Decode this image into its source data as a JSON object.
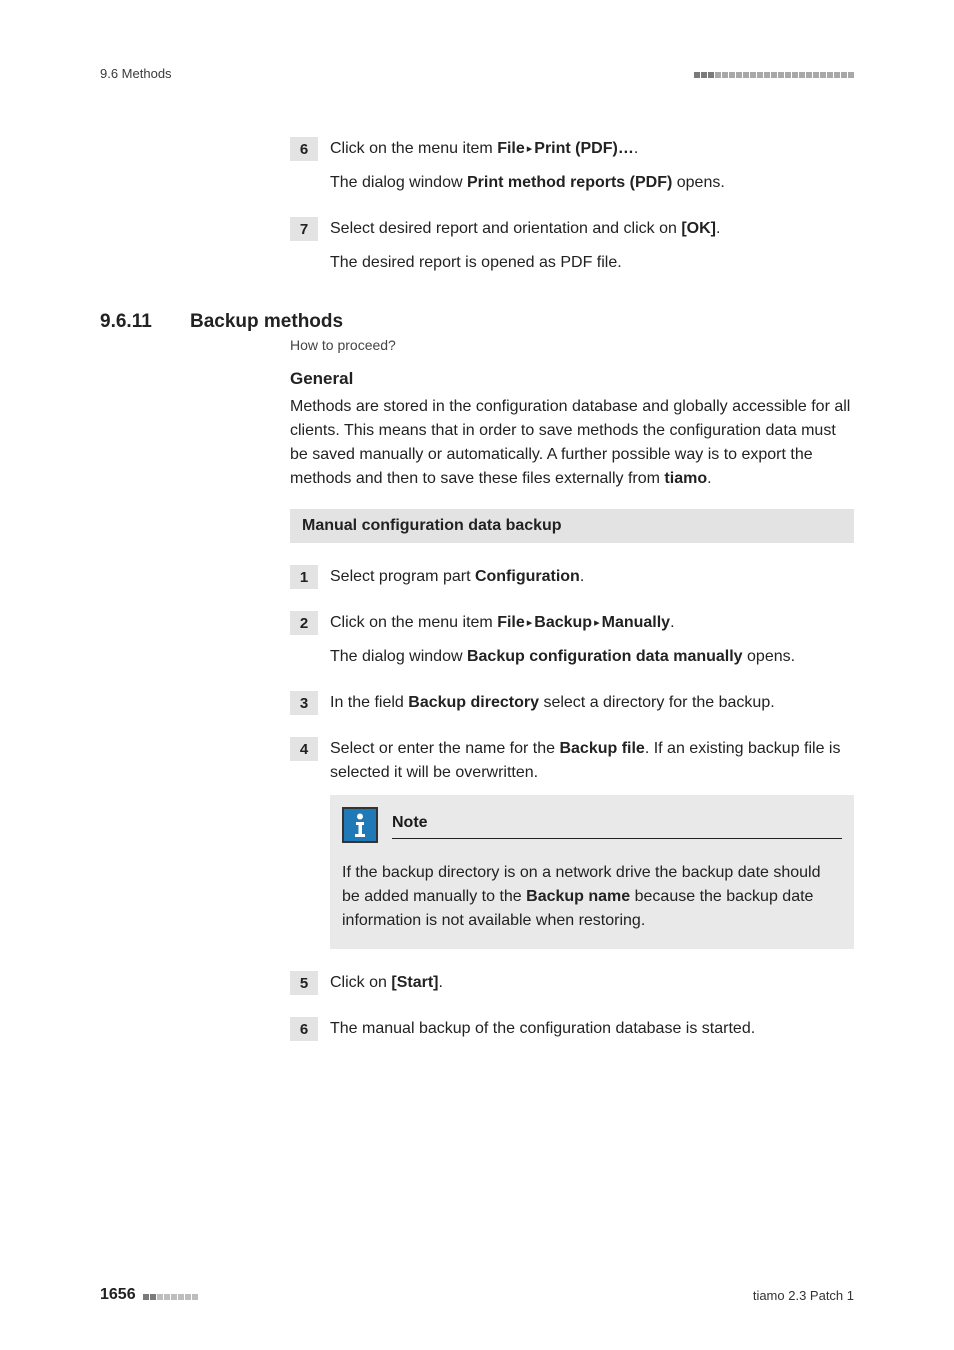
{
  "header": {
    "left": "9.6 Methods"
  },
  "preSteps": {
    "s6": {
      "line1_a": "Click on the menu item ",
      "line1_b": "File",
      "line1_c": "Print (PDF)…",
      "line1_d": ".",
      "line2_a": "The dialog window ",
      "line2_b": "Print method reports (PDF)",
      "line2_c": " opens."
    },
    "s7": {
      "line1_a": "Select desired report and orientation and click on ",
      "line1_b": "[OK]",
      "line1_c": ".",
      "line2": "The desired report is opened as PDF file."
    }
  },
  "section": {
    "num": "9.6.11",
    "title": "Backup methods",
    "howto": "How to proceed?",
    "generalHeading": "General",
    "generalPara_a": "Methods are stored in the configuration database and globally accessible for all clients. This means that in order to save methods the configuration data must be saved manually or automatically. A further possible way is to export the methods and then to save these files externally from ",
    "generalPara_b": "tiamo",
    "generalPara_c": "."
  },
  "instrBar": "Manual configuration data backup",
  "steps": {
    "n1": "1",
    "n2": "2",
    "n3": "3",
    "n4": "4",
    "n5": "5",
    "n6": "6",
    "n7": "7",
    "s1_a": "Select program part ",
    "s1_b": "Configuration",
    "s1_c": ".",
    "s2_l1_a": "Click on the menu item ",
    "s2_l1_b": "File",
    "s2_l1_c": "Backup",
    "s2_l1_d": "Manually",
    "s2_l1_e": ".",
    "s2_l2_a": "The dialog window ",
    "s2_l2_b": "Backup configuration data manually",
    "s2_l2_c": " opens.",
    "s3_a": "In the field ",
    "s3_b": "Backup directory",
    "s3_c": " select a directory for the backup.",
    "s4_a": "Select or enter the name for the ",
    "s4_b": "Backup file",
    "s4_c": ". If an existing backup file is selected it will be overwritten.",
    "note_title": "Note",
    "note_body_a": "If the backup directory is on a network drive the backup date should be added manually to the ",
    "note_body_b": "Backup name",
    "note_body_c": " because the backup date information is not available when restoring.",
    "s5_a": "Click on ",
    "s5_b": "[Start]",
    "s5_c": ".",
    "s6": "The manual backup of the configuration database is started."
  },
  "footer": {
    "page": "1656",
    "product": "tiamo 2.3 Patch 1"
  },
  "glyphs": {
    "tri": "▸"
  }
}
